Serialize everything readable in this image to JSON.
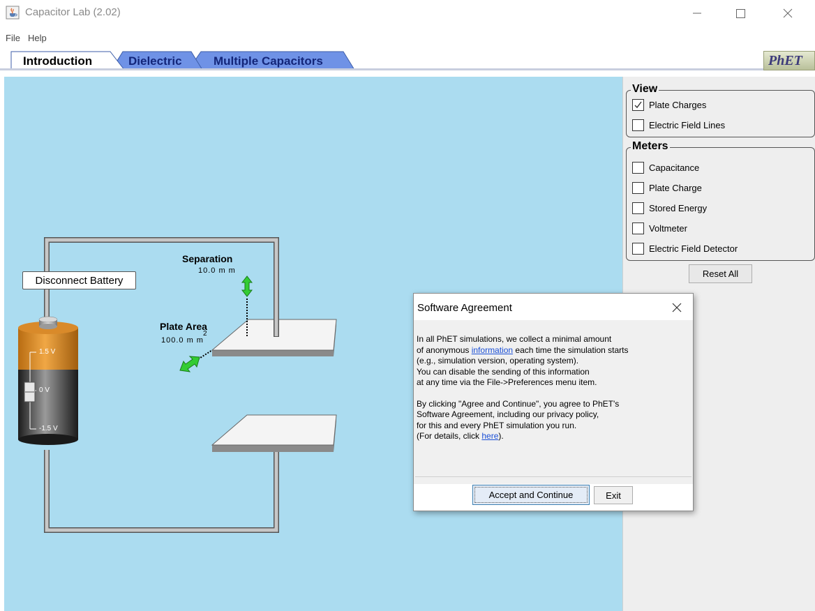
{
  "window": {
    "title": "Capacitor Lab (2.02)"
  },
  "menu": {
    "file": "File",
    "help": "Help"
  },
  "tabs": [
    {
      "label": "Introduction",
      "active": true
    },
    {
      "label": "Dielectric",
      "active": false
    },
    {
      "label": "Multiple Capacitors",
      "active": false
    }
  ],
  "logo": {
    "text": "PhET"
  },
  "scene": {
    "disconnect_button": "Disconnect Battery",
    "separation_label": "Separation",
    "separation_value": "10.0 m m",
    "plate_area_label": "Plate Area",
    "plate_area_value": "100.0 m m",
    "plate_area_exponent": "2",
    "battery": {
      "top_label": "1.5 V",
      "mid_label": "0 V",
      "bottom_label": "-1.5 V"
    }
  },
  "control_panel": {
    "view": {
      "title": "View",
      "items": [
        {
          "label": "Plate Charges",
          "checked": true
        },
        {
          "label": "Electric Field Lines",
          "checked": false
        }
      ]
    },
    "meters": {
      "title": "Meters",
      "items": [
        {
          "label": "Capacitance",
          "checked": false
        },
        {
          "label": "Plate Charge",
          "checked": false
        },
        {
          "label": "Stored Energy",
          "checked": false
        },
        {
          "label": "Voltmeter",
          "checked": false
        },
        {
          "label": "Electric Field Detector",
          "checked": false
        }
      ]
    },
    "reset_all": "Reset All"
  },
  "dialog": {
    "title": "Software Agreement",
    "p1_a": "In all PhET simulations, we collect a minimal amount",
    "p1_b": "of anonymous ",
    "p1_link": "information",
    "p1_c": " each time the simulation starts",
    "p1_d": "(e.g., simulation version, operating system).",
    "p1_e": "You can disable the sending of this information",
    "p1_f": "at any time via the File->Preferences menu item.",
    "p2_a": "By clicking \"Agree and Continue\", you agree to PhET's",
    "p2_b": "Software Agreement, including our privacy policy,",
    "p2_c": "for this and every PhET simulation you run.",
    "p2_d": "(For details, click ",
    "p2_link": "here",
    "p2_e": ").",
    "accept": "Accept and Continue",
    "exit": "Exit"
  },
  "colors": {
    "play_area": "#abdcf0",
    "tab_active": "#ffffff",
    "tab_inactive": "#6f92e6",
    "battery_top": "#e08a1e",
    "battery_bottom": "#2a2a2a",
    "arrow_green": "#33cc33"
  }
}
